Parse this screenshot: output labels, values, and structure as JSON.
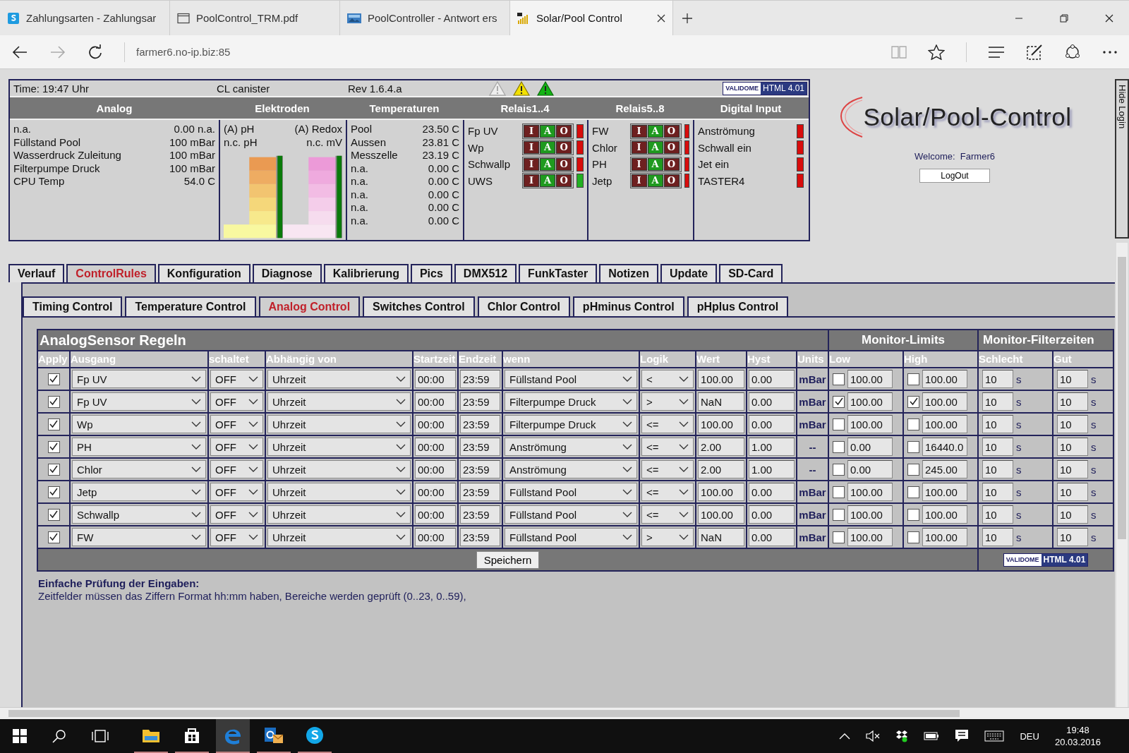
{
  "browser": {
    "tabs": [
      {
        "title": "Zahlungsarten - Zahlungsar",
        "kind": "skype",
        "selected": false
      },
      {
        "title": "PoolControl_TRM.pdf",
        "kind": "document",
        "selected": false
      },
      {
        "title": "PoolController - Antwort ers",
        "kind": "image",
        "selected": false
      },
      {
        "title": "Solar/Pool Control",
        "kind": "bars",
        "selected": true
      }
    ],
    "address": "farmer6.no-ip.biz:85"
  },
  "status": {
    "time": "Time: 19:47 Uhr",
    "note": "CL canister",
    "revision": "Rev 1.6.4.a",
    "validator": {
      "logo": "VALIDOME",
      "label": "HTML 4.01"
    },
    "headings": [
      "Analog",
      "Elektroden",
      "Temperaturen",
      "Relais1..4",
      "Relais5..8",
      "Digital Input"
    ],
    "analog": [
      {
        "name": "n.a.",
        "value": "0.00 n.a."
      },
      {
        "name": "Füllstand Pool",
        "value": "100 mBar"
      },
      {
        "name": "Wasserdruck Zuleitung",
        "value": "100 mBar"
      },
      {
        "name": "Filterpumpe Druck",
        "value": "100 mBar"
      },
      {
        "name": "CPU Temp",
        "value": "54.0 C"
      }
    ],
    "electrodes": {
      "left_title": "(A) pH",
      "right_title": "(A) Redox",
      "left_sub": "n.c. pH",
      "right_sub": "n.c. mV"
    },
    "temperatures": [
      {
        "name": "Pool",
        "value": "23.50 C"
      },
      {
        "name": "Aussen",
        "value": "23.81 C"
      },
      {
        "name": "Messzelle",
        "value": "23.19 C"
      },
      {
        "name": "n.a.",
        "value": "0.00 C"
      },
      {
        "name": "n.a.",
        "value": "0.00 C"
      },
      {
        "name": "n.a.",
        "value": "0.00 C"
      },
      {
        "name": "n.a.",
        "value": "0.00 C"
      },
      {
        "name": "n.a.",
        "value": "0.00 C"
      }
    ],
    "relays_1_4": [
      {
        "name": "Fp UV",
        "on": false,
        "modes": [
          {
            "label": "I",
            "selected": false
          },
          {
            "label": "A",
            "selected": true
          },
          {
            "label": "O",
            "selected": false
          }
        ]
      },
      {
        "name": "Wp",
        "on": false,
        "modes": [
          {
            "label": "I",
            "selected": false
          },
          {
            "label": "A",
            "selected": true
          },
          {
            "label": "O",
            "selected": false
          }
        ]
      },
      {
        "name": "Schwallp",
        "on": false,
        "modes": [
          {
            "label": "I",
            "selected": false
          },
          {
            "label": "A",
            "selected": true
          },
          {
            "label": "O",
            "selected": false
          }
        ]
      },
      {
        "name": "UWS",
        "on": true,
        "modes": [
          {
            "label": "I",
            "selected": false
          },
          {
            "label": "A",
            "selected": true
          },
          {
            "label": "O",
            "selected": false
          }
        ]
      }
    ],
    "relays_5_8": [
      {
        "name": "FW",
        "on": false,
        "modes": [
          {
            "label": "I",
            "selected": false
          },
          {
            "label": "A",
            "selected": true
          },
          {
            "label": "O",
            "selected": false
          }
        ]
      },
      {
        "name": "Chlor",
        "on": false,
        "modes": [
          {
            "label": "I",
            "selected": false
          },
          {
            "label": "A",
            "selected": true
          },
          {
            "label": "O",
            "selected": false
          }
        ]
      },
      {
        "name": "PH",
        "on": false,
        "modes": [
          {
            "label": "I",
            "selected": false
          },
          {
            "label": "A",
            "selected": true
          },
          {
            "label": "O",
            "selected": false
          }
        ]
      },
      {
        "name": "Jetp",
        "on": false,
        "modes": [
          {
            "label": "I",
            "selected": false
          },
          {
            "label": "A",
            "selected": true
          },
          {
            "label": "O",
            "selected": false
          }
        ]
      }
    ],
    "digital_inputs": [
      {
        "name": "Anströmung",
        "on": false
      },
      {
        "name": "Schwall ein",
        "on": false
      },
      {
        "name": "Jet ein",
        "on": false
      },
      {
        "name": "TASTER4",
        "on": false
      }
    ]
  },
  "login": {
    "logo": "Solar/Pool-Control",
    "welcome": "Welcome:  Farmer6",
    "logout": "LogOut",
    "hide": "Hide Login"
  },
  "main_tabs": [
    {
      "label": "Verlauf",
      "selected": false
    },
    {
      "label": "ControlRules",
      "selected": true
    },
    {
      "label": "Konfiguration",
      "selected": false
    },
    {
      "label": "Diagnose",
      "selected": false
    },
    {
      "label": "Kalibrierung",
      "selected": false
    },
    {
      "label": "Pics",
      "selected": false
    },
    {
      "label": "DMX512",
      "selected": false
    },
    {
      "label": "FunkTaster",
      "selected": false
    },
    {
      "label": "Notizen",
      "selected": false
    },
    {
      "label": "Update",
      "selected": false
    },
    {
      "label": "SD-Card",
      "selected": false
    }
  ],
  "sub_tabs": [
    {
      "label": "Timing Control",
      "selected": false
    },
    {
      "label": "Temperature Control",
      "selected": false
    },
    {
      "label": "Analog Control",
      "selected": true
    },
    {
      "label": "Switches Control",
      "selected": false
    },
    {
      "label": "Chlor Control",
      "selected": false
    },
    {
      "label": "pHminus Control",
      "selected": false
    },
    {
      "label": "pHplus Control",
      "selected": false
    }
  ],
  "table": {
    "title": "AnalogSensor Regeln",
    "groups": [
      "Monitor-Limits",
      "Monitor-Filterzeiten"
    ],
    "columns": [
      "Apply",
      "Ausgang",
      "schaltet",
      "Abhängig von",
      "Startzeit",
      "Endzeit",
      "wenn",
      "Logik",
      "Wert",
      "Hyst",
      "Units",
      "Low",
      "High",
      "Schlecht",
      "Gut"
    ],
    "rows": [
      {
        "apply": true,
        "output": "Fp UV",
        "switches": "OFF",
        "depends": "Uhrzeit",
        "start": "00:00",
        "end": "23:59",
        "when": "Füllstand Pool",
        "logic": "<",
        "value": "100.00",
        "hyst": "0.00",
        "units": "mBar",
        "low_checked": false,
        "low": "100.00",
        "high_checked": false,
        "high": "100.00",
        "bad": "10",
        "bad_unit": "s",
        "good": "10",
        "good_unit": "s"
      },
      {
        "apply": true,
        "output": "Fp UV",
        "switches": "OFF",
        "depends": "Uhrzeit",
        "start": "00:00",
        "end": "23:59",
        "when": "Filterpumpe Druck",
        "logic": ">",
        "value": "NaN",
        "hyst": "0.00",
        "units": "mBar",
        "low_checked": true,
        "low": "100.00",
        "high_checked": true,
        "high": "100.00",
        "bad": "10",
        "bad_unit": "s",
        "good": "10",
        "good_unit": "s"
      },
      {
        "apply": true,
        "output": "Wp",
        "switches": "OFF",
        "depends": "Uhrzeit",
        "start": "00:00",
        "end": "23:59",
        "when": "Filterpumpe Druck",
        "logic": "<=",
        "value": "100.00",
        "hyst": "0.00",
        "units": "mBar",
        "low_checked": false,
        "low": "100.00",
        "high_checked": false,
        "high": "100.00",
        "bad": "10",
        "bad_unit": "s",
        "good": "10",
        "good_unit": "s"
      },
      {
        "apply": true,
        "output": "PH",
        "switches": "OFF",
        "depends": "Uhrzeit",
        "start": "00:00",
        "end": "23:59",
        "when": "Anströmung",
        "logic": "<=",
        "value": "2.00",
        "hyst": "1.00",
        "units": "--",
        "low_checked": false,
        "low": "0.00",
        "high_checked": false,
        "high": "16440.0",
        "bad": "10",
        "bad_unit": "s",
        "good": "10",
        "good_unit": "s"
      },
      {
        "apply": true,
        "output": "Chlor",
        "switches": "OFF",
        "depends": "Uhrzeit",
        "start": "00:00",
        "end": "23:59",
        "when": "Anströmung",
        "logic": "<=",
        "value": "2.00",
        "hyst": "1.00",
        "units": "--",
        "low_checked": false,
        "low": "0.00",
        "high_checked": false,
        "high": "245.00",
        "bad": "10",
        "bad_unit": "s",
        "good": "10",
        "good_unit": "s"
      },
      {
        "apply": true,
        "output": "Jetp",
        "switches": "OFF",
        "depends": "Uhrzeit",
        "start": "00:00",
        "end": "23:59",
        "when": "Füllstand Pool",
        "logic": "<=",
        "value": "100.00",
        "hyst": "0.00",
        "units": "mBar",
        "low_checked": false,
        "low": "100.00",
        "high_checked": false,
        "high": "100.00",
        "bad": "10",
        "bad_unit": "s",
        "good": "10",
        "good_unit": "s"
      },
      {
        "apply": true,
        "output": "Schwallp",
        "switches": "OFF",
        "depends": "Uhrzeit",
        "start": "00:00",
        "end": "23:59",
        "when": "Füllstand Pool",
        "logic": "<=",
        "value": "100.00",
        "hyst": "0.00",
        "units": "mBar",
        "low_checked": false,
        "low": "100.00",
        "high_checked": false,
        "high": "100.00",
        "bad": "10",
        "bad_unit": "s",
        "good": "10",
        "good_unit": "s"
      },
      {
        "apply": true,
        "output": "FW",
        "switches": "OFF",
        "depends": "Uhrzeit",
        "start": "00:00",
        "end": "23:59",
        "when": "Füllstand Pool",
        "logic": ">",
        "value": "NaN",
        "hyst": "0.00",
        "units": "mBar",
        "low_checked": false,
        "low": "100.00",
        "high_checked": false,
        "high": "100.00",
        "bad": "10",
        "bad_unit": "s",
        "good": "10",
        "good_unit": "s"
      }
    ],
    "save": "Speichern",
    "validator": {
      "logo": "VALIDOME",
      "label": "HTML 4.01"
    }
  },
  "notes": {
    "title": "Einfache Prüfung der Eingaben:",
    "text": "Zeitfelder müssen das Ziffern Format hh:mm haben, Bereiche werden geprüft (0..23, 0..59),"
  },
  "taskbar": {
    "apps": [
      {
        "kind": "explorer",
        "selected": false
      },
      {
        "kind": "store",
        "selected": false
      },
      {
        "kind": "edge",
        "selected": true
      },
      {
        "kind": "outlook",
        "selected": false
      },
      {
        "kind": "skype",
        "selected": false
      }
    ],
    "language": "DEU",
    "time": "19:48",
    "date": "20.03.2016"
  }
}
